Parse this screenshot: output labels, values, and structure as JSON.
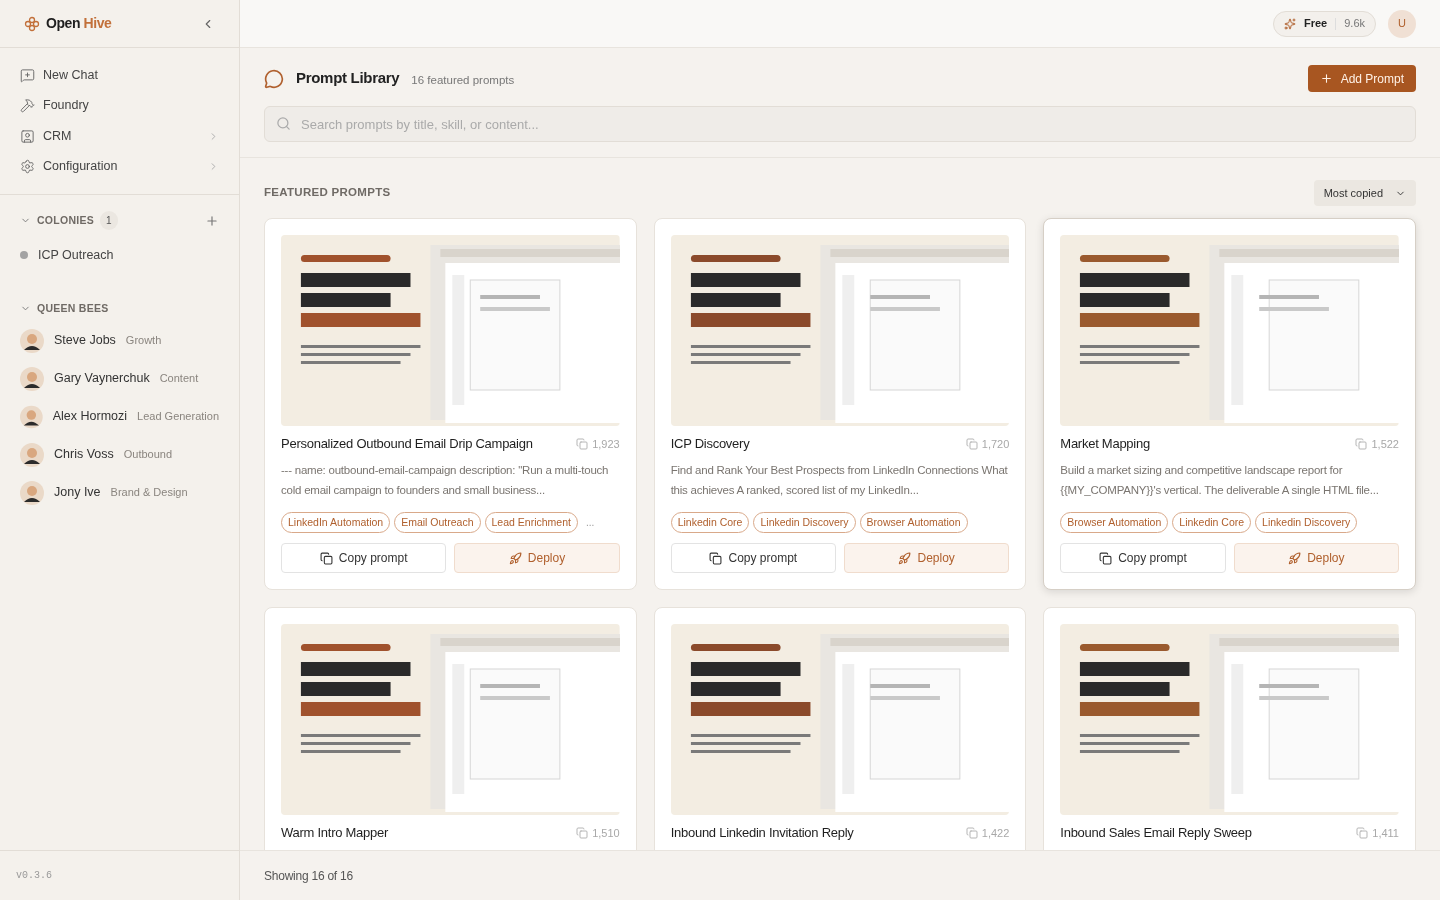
{
  "sidebar": {
    "logo": {
      "first": "Open",
      "second": "Hive"
    },
    "nav": [
      {
        "label": "New Chat",
        "has_submenu": false
      },
      {
        "label": "Foundry",
        "has_submenu": false
      },
      {
        "label": "CRM",
        "has_submenu": true
      },
      {
        "label": "Configuration",
        "has_submenu": true
      }
    ],
    "colonies": {
      "title": "COLONIES",
      "count": "1",
      "expanded": true,
      "items": [
        {
          "label": "ICP Outreach",
          "color": "#a3a3a3"
        }
      ]
    },
    "queen_bees": {
      "title": "QUEEN BEES",
      "expanded": true,
      "items": [
        {
          "name": "Steve Jobs",
          "role": "Growth"
        },
        {
          "name": "Gary Vaynerchuk",
          "role": "Content"
        },
        {
          "name": "Alex Hormozi",
          "role": "Lead Generation"
        },
        {
          "name": "Chris Voss",
          "role": "Outbound"
        },
        {
          "name": "Jony Ive",
          "role": "Brand & Design"
        }
      ]
    },
    "version": "v0.3.6"
  },
  "topbar": {
    "plan": "Free",
    "credits": "9.6k",
    "avatar": "U"
  },
  "library": {
    "title": "Prompt Library",
    "subtitle": "16 featured prompts",
    "add_button": "Add Prompt",
    "search": {
      "placeholder": "Search prompts by title, skill, or content..."
    },
    "section_title": "FEATURED PROMPTS",
    "sort": "Most copied",
    "cards": [
      {
        "title": "Personalized Outbound Email Drip Campaign",
        "copies": "1,923",
        "highlighted": false,
        "description": "--- name: outbound-email-campaign description: \"Run a multi-touch cold email campaign to founders and small business...",
        "tags": [
          "LinkedIn Automation",
          "Email Outreach",
          "Lead Enrichment"
        ],
        "more": "...",
        "copy_button": "Copy prompt",
        "deploy_button": "Deploy"
      },
      {
        "title": "ICP Discovery",
        "copies": "1,720",
        "highlighted": false,
        "description": "Find and Rank Your Best Prospects from LinkedIn Connections What this achieves A ranked, scored list of my LinkedIn...",
        "tags": [
          "Linkedin Core",
          "Linkedin Discovery",
          "Browser Automation"
        ],
        "copy_button": "Copy prompt",
        "deploy_button": "Deploy"
      },
      {
        "title": "Market Mapping",
        "copies": "1,522",
        "highlighted": true,
        "description": "Build a market sizing and competitive landscape report for {{MY_COMPANY}}'s vertical. The deliverable A single HTML file...",
        "tags": [
          "Browser Automation",
          "Linkedin Core",
          "Linkedin Discovery"
        ],
        "copy_button": "Copy prompt",
        "deploy_button": "Deploy"
      },
      {
        "title": "Warm Intro Mapper",
        "copies": "1,510",
        "highlighted": false
      },
      {
        "title": "Inbound Linkedin Invitation Reply",
        "copies": "1,422",
        "highlighted": false
      },
      {
        "title": "Inbound Sales Email Reply Sweep",
        "copies": "1,411",
        "highlighted": false
      }
    ],
    "footer": "Showing 16 of 16"
  }
}
